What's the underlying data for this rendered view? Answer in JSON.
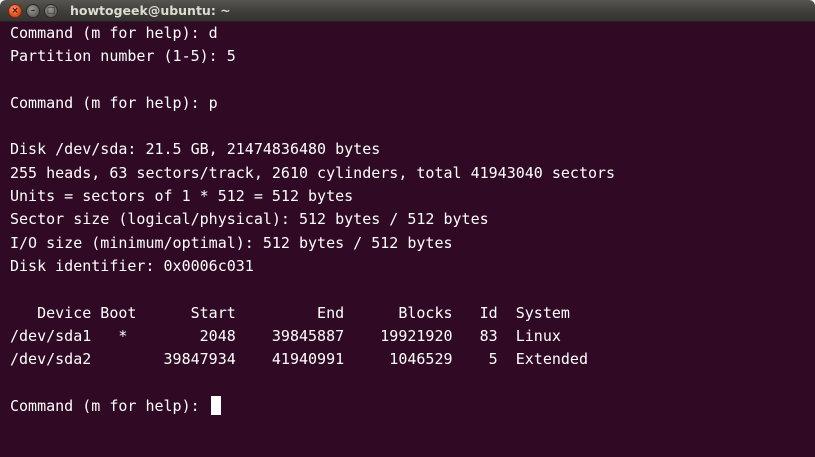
{
  "window": {
    "title": "howtogeek@ubuntu: ~",
    "close_glyph": "×",
    "minimize_glyph": "–",
    "maximize_glyph": "□"
  },
  "terminal": {
    "background": "#300a24",
    "foreground": "#ffffff",
    "lines": [
      "Command (m for help): d",
      "Partition number (1-5): 5",
      "",
      "Command (m for help): p",
      "",
      "Disk /dev/sda: 21.5 GB, 21474836480 bytes",
      "255 heads, 63 sectors/track, 2610 cylinders, total 41943040 sectors",
      "Units = sectors of 1 * 512 = 512 bytes",
      "Sector size (logical/physical): 512 bytes / 512 bytes",
      "I/O size (minimum/optimal): 512 bytes / 512 bytes",
      "Disk identifier: 0x0006c031",
      "",
      "   Device Boot      Start         End      Blocks   Id  System",
      "/dev/sda1   *        2048    39845887    19921920   83  Linux",
      "/dev/sda2        39847934    41940991     1046529    5  Extended",
      "",
      "Command (m for help): "
    ]
  }
}
